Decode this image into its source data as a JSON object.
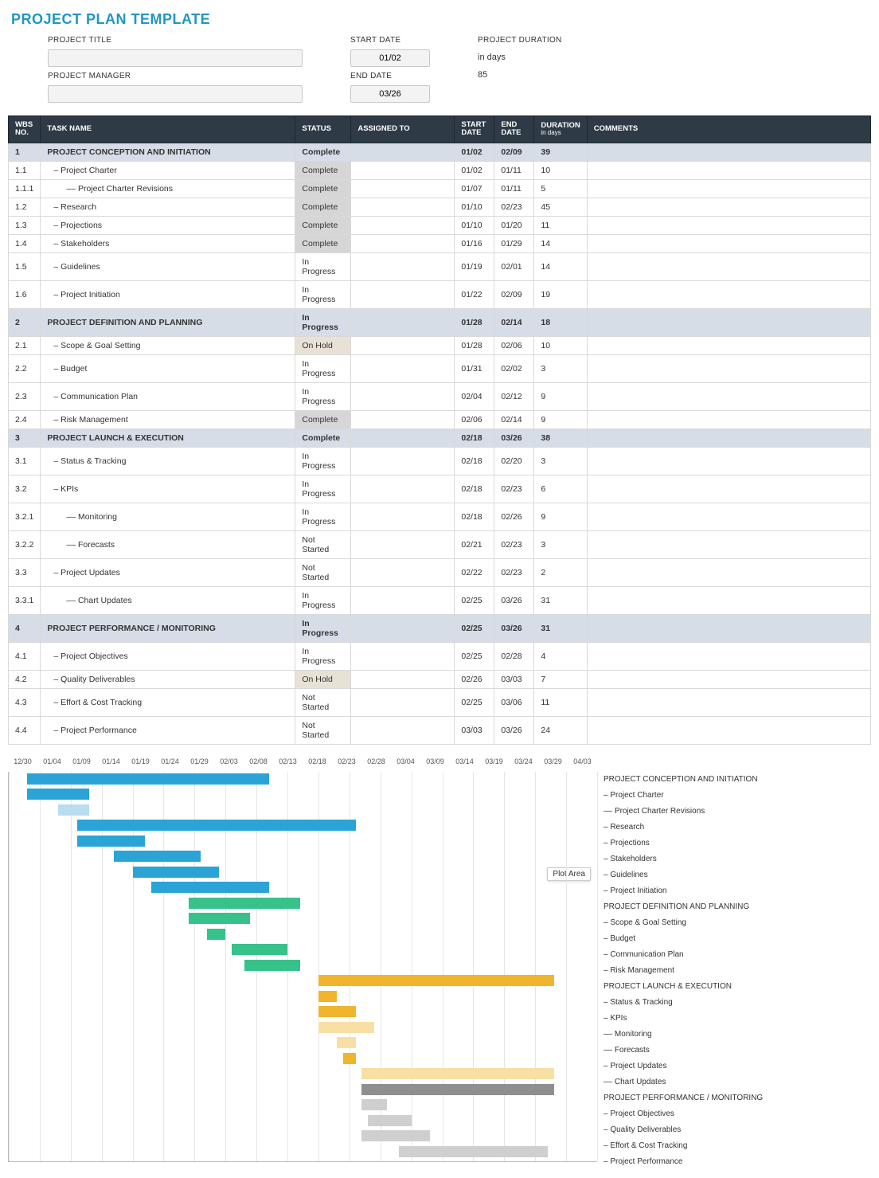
{
  "title": "PROJECT PLAN TEMPLATE",
  "meta": {
    "project_title_label": "PROJECT TITLE",
    "project_title_value": "",
    "project_manager_label": "PROJECT MANAGER",
    "project_manager_value": "",
    "start_date_label": "START DATE",
    "start_date_value": "01/02",
    "end_date_label": "END DATE",
    "end_date_value": "03/26",
    "project_duration_label": "PROJECT DURATION",
    "project_duration_unit": "in days",
    "project_duration_value": "85"
  },
  "columns": {
    "wbs": "WBS NO.",
    "task": "TASK NAME",
    "status": "STATUS",
    "assigned": "ASSIGNED TO",
    "start": "START DATE",
    "end": "END DATE",
    "duration": "DURATION",
    "duration_sub": "in days",
    "comments": "COMMENTS"
  },
  "rows": [
    {
      "wbs": "1",
      "task": "PROJECT CONCEPTION AND INITIATION",
      "status": "Complete",
      "start": "01/02",
      "end": "02/09",
      "dur": "39",
      "section": true
    },
    {
      "wbs": "1.1",
      "task": "– Project Charter",
      "status": "Complete",
      "start": "01/02",
      "end": "01/11",
      "dur": "10",
      "indent": 1,
      "sc": "complete"
    },
    {
      "wbs": "1.1.1",
      "task": "–– Project Charter Revisions",
      "status": "Complete",
      "start": "01/07",
      "end": "01/11",
      "dur": "5",
      "indent": 2,
      "sc": "complete"
    },
    {
      "wbs": "1.2",
      "task": "– Research",
      "status": "Complete",
      "start": "01/10",
      "end": "02/23",
      "dur": "45",
      "indent": 1,
      "sc": "complete"
    },
    {
      "wbs": "1.3",
      "task": "– Projections",
      "status": "Complete",
      "start": "01/10",
      "end": "01/20",
      "dur": "11",
      "indent": 1,
      "sc": "complete"
    },
    {
      "wbs": "1.4",
      "task": "– Stakeholders",
      "status": "Complete",
      "start": "01/16",
      "end": "01/29",
      "dur": "14",
      "indent": 1,
      "sc": "complete"
    },
    {
      "wbs": "1.5",
      "task": "– Guidelines",
      "status": "In Progress",
      "start": "01/19",
      "end": "02/01",
      "dur": "14",
      "indent": 1
    },
    {
      "wbs": "1.6",
      "task": "– Project Initiation",
      "status": "In Progress",
      "start": "01/22",
      "end": "02/09",
      "dur": "19",
      "indent": 1
    },
    {
      "wbs": "2",
      "task": "PROJECT DEFINITION AND PLANNING",
      "status": "In Progress",
      "start": "01/28",
      "end": "02/14",
      "dur": "18",
      "section": true
    },
    {
      "wbs": "2.1",
      "task": "– Scope & Goal Setting",
      "status": "On Hold",
      "start": "01/28",
      "end": "02/06",
      "dur": "10",
      "indent": 1,
      "sc": "onhold"
    },
    {
      "wbs": "2.2",
      "task": "– Budget",
      "status": "In Progress",
      "start": "01/31",
      "end": "02/02",
      "dur": "3",
      "indent": 1
    },
    {
      "wbs": "2.3",
      "task": "– Communication Plan",
      "status": "In Progress",
      "start": "02/04",
      "end": "02/12",
      "dur": "9",
      "indent": 1
    },
    {
      "wbs": "2.4",
      "task": "– Risk Management",
      "status": "Complete",
      "start": "02/06",
      "end": "02/14",
      "dur": "9",
      "indent": 1,
      "sc": "complete"
    },
    {
      "wbs": "3",
      "task": "PROJECT LAUNCH & EXECUTION",
      "status": "Complete",
      "start": "02/18",
      "end": "03/26",
      "dur": "38",
      "section": true
    },
    {
      "wbs": "3.1",
      "task": "– Status & Tracking",
      "status": "In Progress",
      "start": "02/18",
      "end": "02/20",
      "dur": "3",
      "indent": 1
    },
    {
      "wbs": "3.2",
      "task": "– KPIs",
      "status": "In Progress",
      "start": "02/18",
      "end": "02/23",
      "dur": "6",
      "indent": 1
    },
    {
      "wbs": "3.2.1",
      "task": "–– Monitoring",
      "status": "In Progress",
      "start": "02/18",
      "end": "02/26",
      "dur": "9",
      "indent": 2
    },
    {
      "wbs": "3.2.2",
      "task": "–– Forecasts",
      "status": "Not Started",
      "start": "02/21",
      "end": "02/23",
      "dur": "3",
      "indent": 2
    },
    {
      "wbs": "3.3",
      "task": "– Project Updates",
      "status": "Not Started",
      "start": "02/22",
      "end": "02/23",
      "dur": "2",
      "indent": 1
    },
    {
      "wbs": "3.3.1",
      "task": "–– Chart Updates",
      "status": "In Progress",
      "start": "02/25",
      "end": "03/26",
      "dur": "31",
      "indent": 2
    },
    {
      "wbs": "4",
      "task": "PROJECT PERFORMANCE / MONITORING",
      "status": "In Progress",
      "start": "02/25",
      "end": "03/26",
      "dur": "31",
      "section": true
    },
    {
      "wbs": "4.1",
      "task": "– Project Objectives",
      "status": "In Progress",
      "start": "02/25",
      "end": "02/28",
      "dur": "4",
      "indent": 1
    },
    {
      "wbs": "4.2",
      "task": "– Quality Deliverables",
      "status": "On Hold",
      "start": "02/26",
      "end": "03/03",
      "dur": "7",
      "indent": 1,
      "sc": "onhold"
    },
    {
      "wbs": "4.3",
      "task": "– Effort & Cost Tracking",
      "status": "Not Started",
      "start": "02/25",
      "end": "03/06",
      "dur": "11",
      "indent": 1
    },
    {
      "wbs": "4.4",
      "task": "– Project Performance",
      "status": "Not Started",
      "start": "03/03",
      "end": "03/26",
      "dur": "24",
      "indent": 1
    }
  ],
  "chart_data": {
    "type": "bar",
    "title": "",
    "plot_area_tooltip": "Plot Area",
    "x_axis_ticks": [
      "12/30",
      "01/04",
      "01/09",
      "01/14",
      "01/19",
      "01/24",
      "01/29",
      "02/03",
      "02/08",
      "02/13",
      "02/18",
      "02/23",
      "02/28",
      "03/04",
      "03/09",
      "03/14",
      "03/19",
      "03/24",
      "03/29",
      "04/03"
    ],
    "x_range_days": [
      0,
      95
    ],
    "colors": {
      "section1": "#2aa3d6",
      "section1_light": "#b7ddee",
      "section2": "#37c28b",
      "section2_light": "#aee7cf",
      "section3": "#f0b52d",
      "section3_light": "#f8e0a5",
      "section4": "#8f8f8f",
      "section4_light": "#cfcfcf"
    },
    "series": [
      {
        "name": "PROJECT CONCEPTION AND INITIATION",
        "start_day": 3,
        "duration": 39,
        "color": "section1"
      },
      {
        "name": "– Project Charter",
        "start_day": 3,
        "duration": 10,
        "color": "section1"
      },
      {
        "name": "–– Project Charter Revisions",
        "start_day": 8,
        "duration": 5,
        "color": "section1_light"
      },
      {
        "name": "– Research",
        "start_day": 11,
        "duration": 45,
        "color": "section1"
      },
      {
        "name": "– Projections",
        "start_day": 11,
        "duration": 11,
        "color": "section1"
      },
      {
        "name": "– Stakeholders",
        "start_day": 17,
        "duration": 14,
        "color": "section1"
      },
      {
        "name": "– Guidelines",
        "start_day": 20,
        "duration": 14,
        "color": "section1"
      },
      {
        "name": "– Project Initiation",
        "start_day": 23,
        "duration": 19,
        "color": "section1"
      },
      {
        "name": "PROJECT DEFINITION AND PLANNING",
        "start_day": 29,
        "duration": 18,
        "color": "section2"
      },
      {
        "name": "– Scope & Goal Setting",
        "start_day": 29,
        "duration": 10,
        "color": "section2"
      },
      {
        "name": "– Budget",
        "start_day": 32,
        "duration": 3,
        "color": "section2"
      },
      {
        "name": "– Communication Plan",
        "start_day": 36,
        "duration": 9,
        "color": "section2"
      },
      {
        "name": "– Risk Management",
        "start_day": 38,
        "duration": 9,
        "color": "section2"
      },
      {
        "name": "PROJECT LAUNCH & EXECUTION",
        "start_day": 50,
        "duration": 38,
        "color": "section3"
      },
      {
        "name": "– Status & Tracking",
        "start_day": 50,
        "duration": 3,
        "color": "section3"
      },
      {
        "name": "– KPIs",
        "start_day": 50,
        "duration": 6,
        "color": "section3"
      },
      {
        "name": "–– Monitoring",
        "start_day": 50,
        "duration": 9,
        "color": "section3_light"
      },
      {
        "name": "–– Forecasts",
        "start_day": 53,
        "duration": 3,
        "color": "section3_light"
      },
      {
        "name": "– Project Updates",
        "start_day": 54,
        "duration": 2,
        "color": "section3"
      },
      {
        "name": "–– Chart Updates",
        "start_day": 57,
        "duration": 31,
        "color": "section3_light"
      },
      {
        "name": "PROJECT PERFORMANCE / MONITORING",
        "start_day": 57,
        "duration": 31,
        "color": "section4"
      },
      {
        "name": "– Project Objectives",
        "start_day": 57,
        "duration": 4,
        "color": "section4_light"
      },
      {
        "name": "– Quality Deliverables",
        "start_day": 58,
        "duration": 7,
        "color": "section4_light"
      },
      {
        "name": "– Effort & Cost Tracking",
        "start_day": 57,
        "duration": 11,
        "color": "section4_light"
      },
      {
        "name": "– Project Performance",
        "start_day": 63,
        "duration": 24,
        "color": "section4_light"
      }
    ]
  }
}
